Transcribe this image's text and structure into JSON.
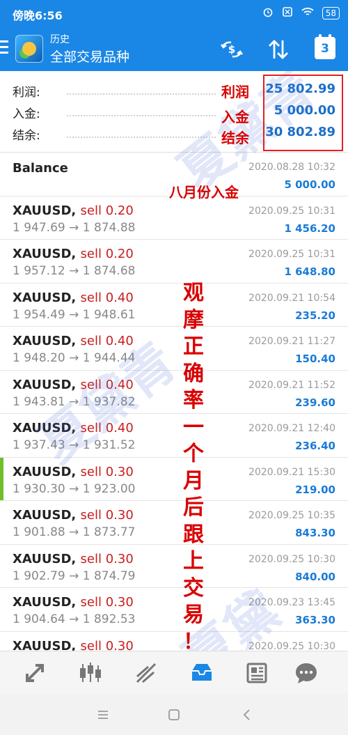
{
  "status_bar": {
    "time": "傍晚6:56",
    "battery": "58"
  },
  "toolbar": {
    "subtitle": "历史",
    "title": "全部交易品种",
    "calendar_day": "3"
  },
  "summary": {
    "rows": [
      {
        "label": "利润:",
        "value": "25 802.99"
      },
      {
        "label": "入金:",
        "value": "5 000.00"
      },
      {
        "label": "结余:",
        "value": "30 802.89"
      }
    ]
  },
  "handwritten": {
    "profit": "利润",
    "deposit": "入金",
    "balance": "结余",
    "august_deposit": "八月份入金",
    "vertical_note": [
      "观",
      "摩",
      "正",
      "确",
      "率",
      "一",
      "个",
      "月",
      "后",
      "跟",
      "上",
      "交",
      "易",
      "！"
    ]
  },
  "watermark": [
    "夏黛青",
    "夏黛青",
    "夏黛青"
  ],
  "balance_row": {
    "label": "Balance",
    "date": "2020.08.28 10:32",
    "amount": "5 000.00"
  },
  "trades": [
    {
      "symbol": "XAUUSD,",
      "side": "sell 0.20",
      "prices": "1 947.69 → 1 874.88",
      "date": "2020.09.25 10:31",
      "profit": "1 456.20"
    },
    {
      "symbol": "XAUUSD,",
      "side": "sell 0.20",
      "prices": "1 957.12 → 1 874.68",
      "date": "2020.09.25 10:31",
      "profit": "1 648.80"
    },
    {
      "symbol": "XAUUSD,",
      "side": "sell 0.40",
      "prices": "1 954.49 → 1 948.61",
      "date": "2020.09.21 10:54",
      "profit": "235.20"
    },
    {
      "symbol": "XAUUSD,",
      "side": "sell 0.40",
      "prices": "1 948.20 → 1 944.44",
      "date": "2020.09.21 11:27",
      "profit": "150.40"
    },
    {
      "symbol": "XAUUSD,",
      "side": "sell 0.40",
      "prices": "1 943.81 → 1 937.82",
      "date": "2020.09.21 11:52",
      "profit": "239.60"
    },
    {
      "symbol": "XAUUSD,",
      "side": "sell 0.40",
      "prices": "1 937.43 → 1 931.52",
      "date": "2020.09.21 12:40",
      "profit": "236.40"
    },
    {
      "symbol": "XAUUSD,",
      "side": "sell 0.30",
      "prices": "1 930.30 → 1 923.00",
      "date": "2020.09.21 15:30",
      "profit": "219.00"
    },
    {
      "symbol": "XAUUSD,",
      "side": "sell 0.30",
      "prices": "1 901.88 → 1 873.77",
      "date": "2020.09.25 10:35",
      "profit": "843.30"
    },
    {
      "symbol": "XAUUSD,",
      "side": "sell 0.30",
      "prices": "1 902.79 → 1 874.79",
      "date": "2020.09.25 10:30",
      "profit": "840.00"
    },
    {
      "symbol": "XAUUSD,",
      "side": "sell 0.30",
      "prices": "1 904.64 → 1 892.53",
      "date": "2020.09.23 13:45",
      "profit": "363.30"
    },
    {
      "symbol": "XAUUSD,",
      "side": "sell 0.30",
      "prices": "",
      "date": "2020.09.25 10:30",
      "profit": ""
    }
  ],
  "icons": {
    "menu": "menu-icon",
    "exchange": "dollar-exchange-icon",
    "sort": "sort-icon",
    "calendar": "calendar-icon",
    "quotes": "quotes-icon",
    "chart": "candlestick-chart-icon",
    "trade": "trade-icon",
    "history": "history-icon",
    "news": "news-icon",
    "chat": "chat-icon"
  },
  "colors": {
    "primary": "#1a87e6",
    "profit_blue": "#1a7bd6",
    "sell_red": "#c81e1e",
    "annotation_red": "#d90000",
    "highlight_green": "#6fbf2a"
  }
}
